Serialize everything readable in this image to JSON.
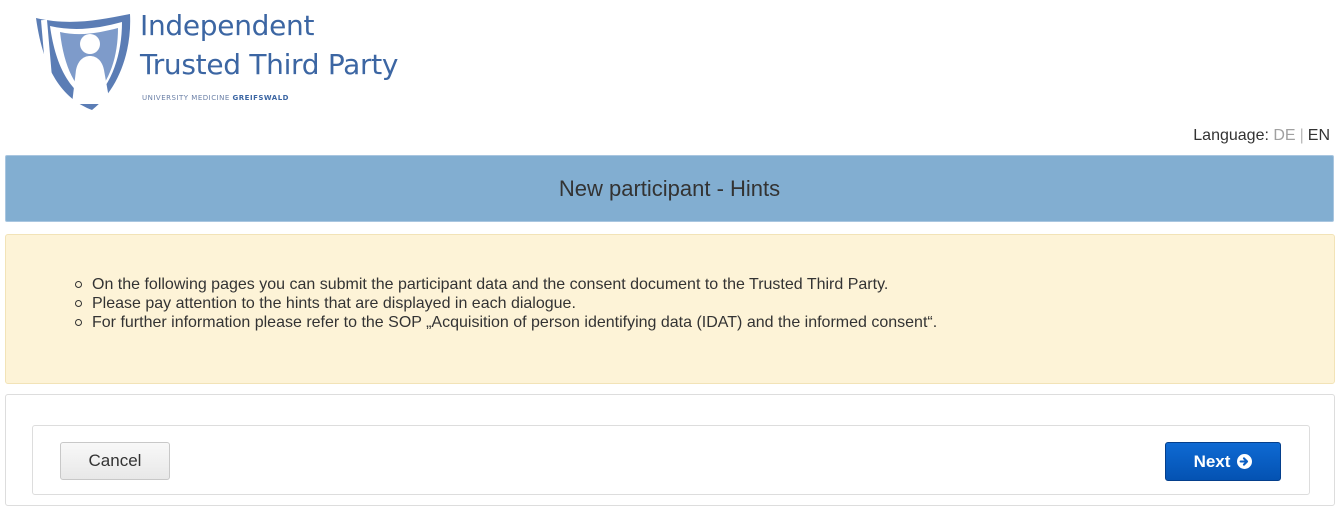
{
  "brand": {
    "line1": "Independent",
    "line2": "Trusted Third Party",
    "subtitle_regular": "UNIVERSITY MEDICINE ",
    "subtitle_bold": "GREIFSWALD",
    "logo_icon": "shield-person-logo",
    "color": "#3c66a3"
  },
  "language": {
    "label": "Language:",
    "options": [
      "DE",
      "EN"
    ],
    "selected": "EN",
    "separator": "|"
  },
  "page": {
    "title": "New participant - Hints",
    "title_bar_color": "#82aed1"
  },
  "hints": {
    "background_color": "#fdf3d7",
    "items": [
      "On the following pages you can submit the participant data and the consent document to the Trusted Third Party.",
      "Please pay attention to the hints that are displayed in each dialogue.",
      "For further information please refer to the SOP „Acquisition of person identifying data (IDAT) and the informed consent“."
    ]
  },
  "actions": {
    "cancel_label": "Cancel",
    "next_label": "Next",
    "next_icon": "arrow-circle-right-icon",
    "next_color": "#0a5fc4"
  }
}
